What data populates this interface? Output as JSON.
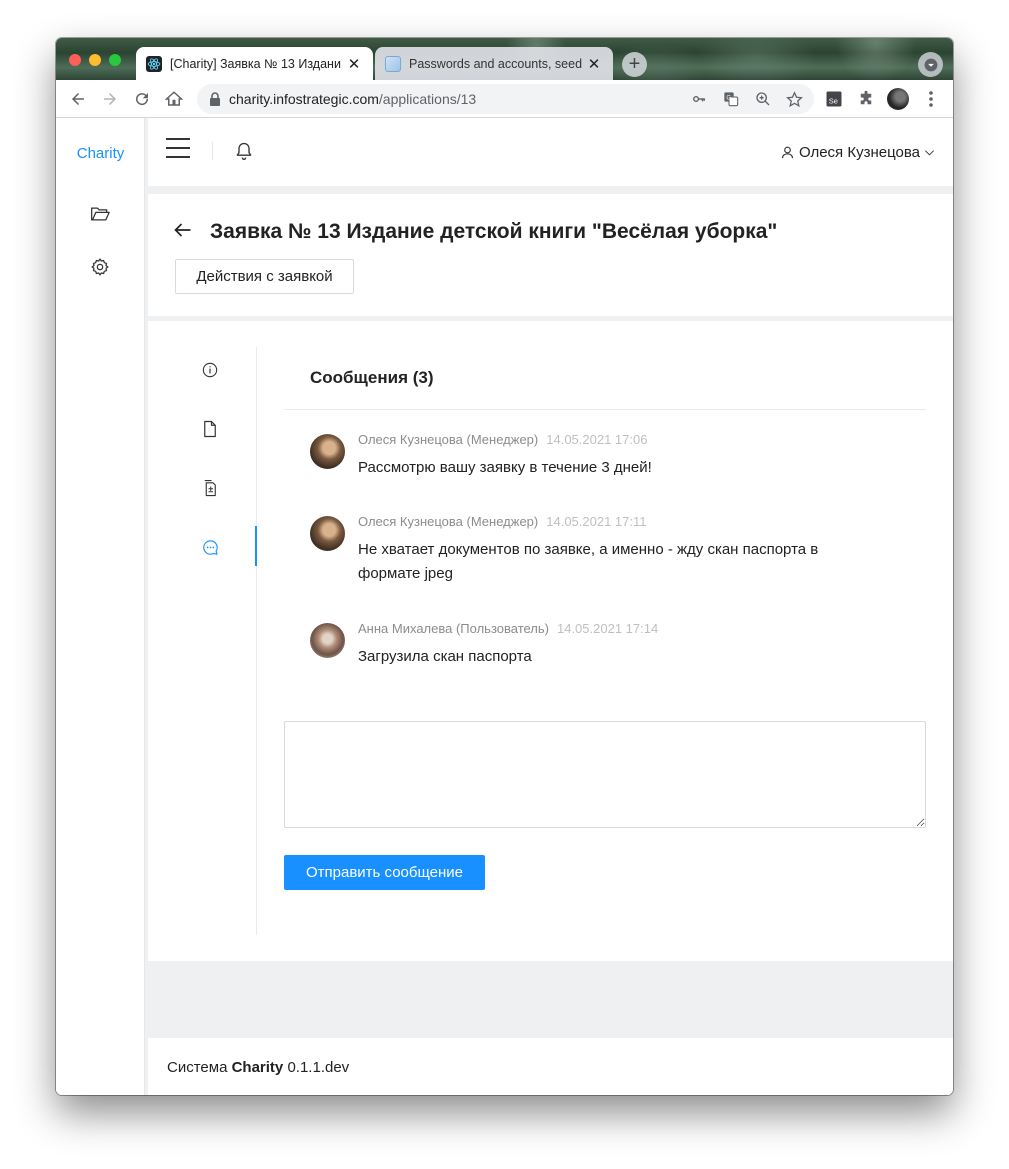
{
  "browser": {
    "tabs": [
      {
        "title": "[Charity] Заявка № 13 Издани",
        "close": "✕",
        "active": true
      },
      {
        "title": "Passwords and accounts, seed",
        "close": "✕",
        "active": false
      }
    ],
    "new_tab": "+",
    "url_host": "charity.infostrategic.com",
    "url_path": "/applications/13"
  },
  "sidebar": {
    "brand": "Charity",
    "items": [
      {
        "icon": "folder-open-icon"
      },
      {
        "icon": "gear-icon"
      }
    ]
  },
  "header": {
    "user_name": "Олеся Кузнецова"
  },
  "page": {
    "title": "Заявка № 13 Издание детской книги \"Весёлая уборка\"",
    "actions_button": "Действия с заявкой"
  },
  "messages": {
    "title": "Сообщения (3)",
    "items": [
      {
        "author": "Олеся Кузнецова (Менеджер)",
        "date": "14.05.2021 17:06",
        "text": "Рассмотрю вашу заявку в течение 3 дней!"
      },
      {
        "author": "Олеся Кузнецова (Менеджер)",
        "date": "14.05.2021 17:11",
        "text": "Не хватает документов по заявке, а именно - жду скан паспорта в формате jpeg"
      },
      {
        "author": "Анна Михалева (Пользователь)",
        "date": "14.05.2021 17:14",
        "text": "Загрузила скан паспорта"
      }
    ],
    "reply_value": "",
    "send_button": "Отправить сообщение"
  },
  "footer": {
    "prefix": "Система",
    "brand": "Charity",
    "version": "0.1.1.dev"
  },
  "colors": {
    "accent": "#1890ff",
    "traffic_red": "#fe5f57",
    "traffic_yellow": "#febc2e",
    "traffic_green": "#28c840"
  }
}
